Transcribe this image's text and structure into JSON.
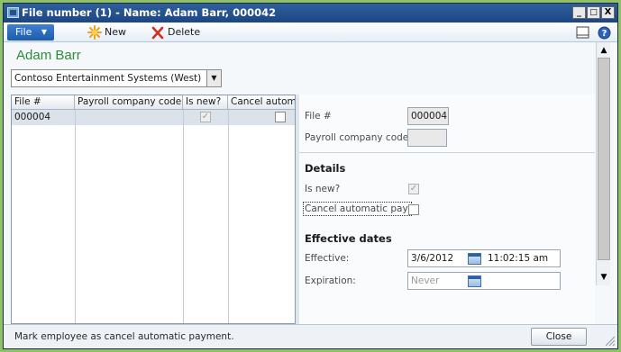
{
  "window": {
    "title": "File number (1) - Name: Adam Barr, 000042",
    "controls": [
      "_",
      "□",
      "X"
    ]
  },
  "toolbar": {
    "file_label": "File",
    "new_label": "New",
    "delete_label": "Delete",
    "icons": [
      "star-new-icon",
      "red-x-delete-icon",
      "panel-icon",
      "help-icon"
    ]
  },
  "record": {
    "title": "Adam Barr",
    "company": "Contoso Entertainment Systems (West)"
  },
  "grid": {
    "headers": [
      "File #",
      "Payroll company code",
      "Is new?",
      "Cancel autom"
    ],
    "rows": [
      {
        "file": "000004",
        "payroll_code": "",
        "is_new": true,
        "cancel_auto": false
      }
    ]
  },
  "detail": {
    "file_label": "File #",
    "file_value": "000004",
    "payroll_label": "Payroll company code:",
    "payroll_value": "",
    "details_heading": "Details",
    "is_new_label": "Is new?",
    "is_new_checked": true,
    "cancel_label": "Cancel automatic pay:",
    "cancel_checked": false,
    "effective_heading": "Effective dates",
    "effective_label": "Effective:",
    "effective_date": "3/6/2012",
    "effective_time": "11:02:15 am",
    "expiration_label": "Expiration:",
    "expiration_placeholder": "Never"
  },
  "status": {
    "message": "Mark employee as cancel automatic payment.",
    "close_label": "Close"
  },
  "colors": {
    "title_bar": "#1d4682",
    "file_button": "#1d5bab",
    "record_title": "#2e8b3a",
    "selected_row": "#dbe2ea"
  }
}
